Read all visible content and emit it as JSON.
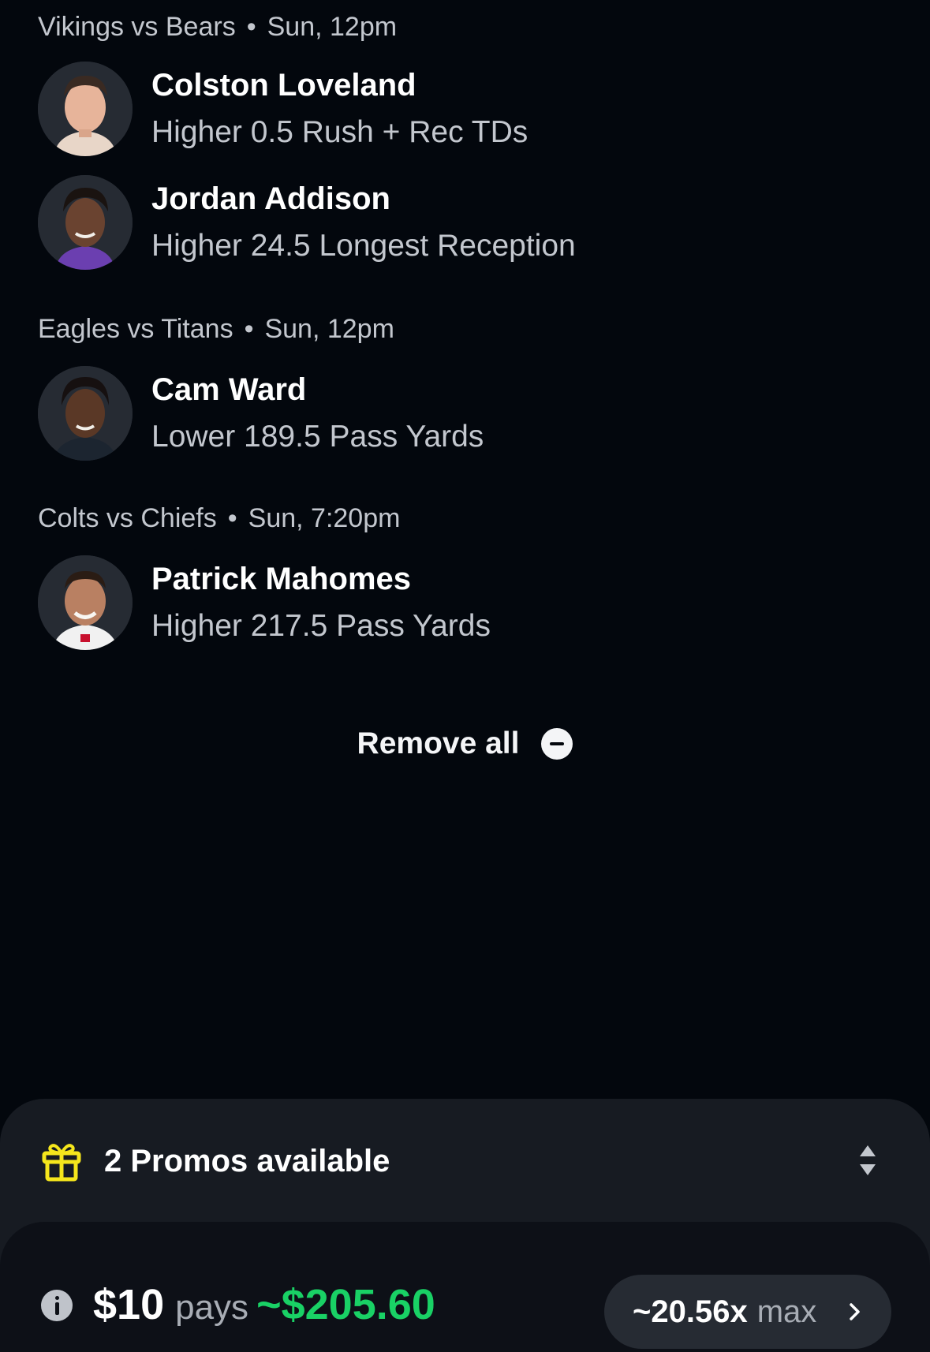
{
  "games": [
    {
      "matchup": "Vikings vs Bears",
      "time": "Sun, 12pm",
      "picks": [
        {
          "player": "Colston Loveland",
          "line": "Higher 0.5 Rush + Rec TDs",
          "avatar_icon": "player-photo"
        },
        {
          "player": "Jordan Addison",
          "line": "Higher 24.5 Longest Reception",
          "avatar_icon": "player-photo"
        }
      ]
    },
    {
      "matchup": "Eagles vs Titans",
      "time": "Sun, 12pm",
      "picks": [
        {
          "player": "Cam Ward",
          "line": "Lower 189.5 Pass Yards",
          "avatar_icon": "player-photo"
        }
      ]
    },
    {
      "matchup": "Colts vs Chiefs",
      "time": "Sun, 7:20pm",
      "picks": [
        {
          "player": "Patrick Mahomes",
          "line": "Higher 217.5 Pass Yards",
          "avatar_icon": "player-photo"
        }
      ]
    }
  ],
  "separator": "•",
  "remove_all": {
    "label": "Remove all",
    "icon": "minus-circle-icon"
  },
  "promos": {
    "label": "2 Promos available",
    "icon": "gift-icon",
    "toggle_icon": "sort-icon"
  },
  "payout": {
    "info_icon": "info-icon",
    "stake": "$10",
    "pays_label": "pays",
    "amount": "~$205.60",
    "multiplier": "~20.56x",
    "max_label": "max",
    "chevron_icon": "chevron-right-icon"
  },
  "colors": {
    "background": "#03070d",
    "payout_green": "#19d165",
    "gift_yellow": "#f5e61c",
    "sheet": "#171b22",
    "pill": "#262b33"
  }
}
